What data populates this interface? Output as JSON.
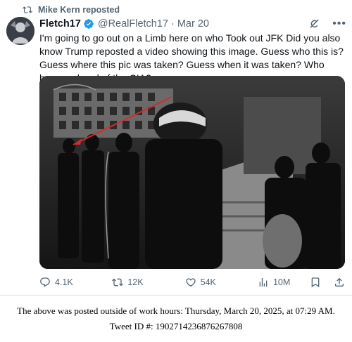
{
  "repost": {
    "label": "Mike Kern reposted"
  },
  "author": {
    "display_name": "Fletch17",
    "handle": "@RealFletch17",
    "separator": "·",
    "date": "Mar 20"
  },
  "tweet": {
    "text": "I'm going to go out on a Limb here on who Took out JFK Did you also know Trump reposted a video showing this image. Guess who this is? Guess where this pic was taken? Guess when it was taken? Who became head of the CIA?"
  },
  "stats": {
    "replies": "4.1K",
    "reposts": "12K",
    "likes": "54K",
    "views": "10M"
  },
  "footer": {
    "line1": "The above was posted outside of work hours: Thursday, March 20, 2025, at 07:29 AM.",
    "line2": "Tweet ID #: 1902714236876267808"
  },
  "colors": {
    "verified": "#1d9bf0",
    "secondary_text": "#536471",
    "annotation_arrow": "#d62b2b"
  },
  "icons": [
    "repost-icon",
    "verified-badge-icon",
    "grok-icon",
    "more-icon",
    "reply-icon",
    "retweet-icon",
    "like-icon",
    "views-icon",
    "bookmark-icon",
    "share-icon"
  ]
}
